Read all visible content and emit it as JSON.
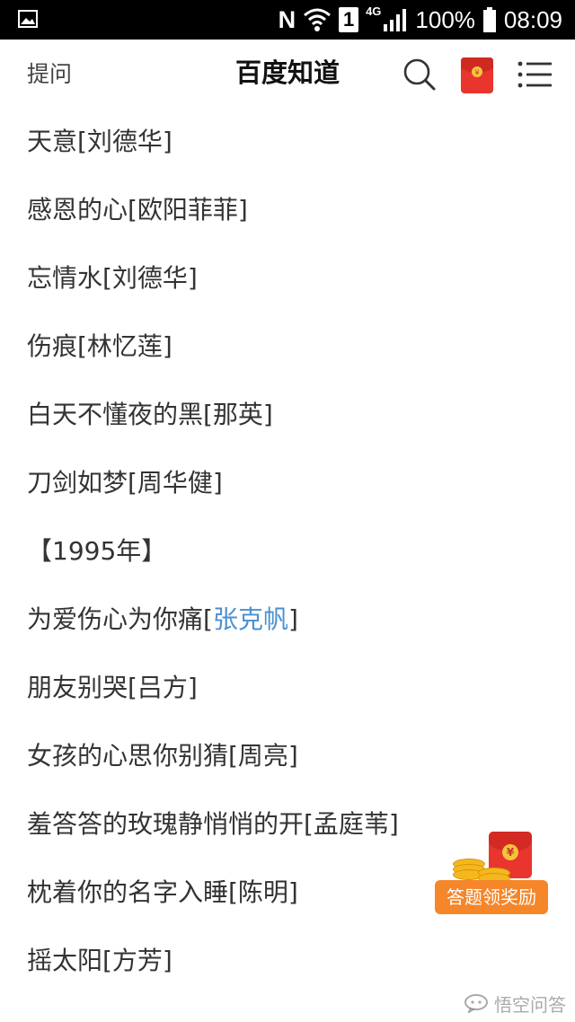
{
  "status_bar": {
    "network_letter": "N",
    "sim_slot": "1",
    "network_type": "4G",
    "battery": "100%",
    "time": "08:09"
  },
  "header": {
    "ask_label": "提问",
    "title": "百度知道"
  },
  "songs": [
    "天意[刘德华]",
    "感恩的心[欧阳菲菲]",
    "忘情水[刘德华]",
    "伤痕[林忆莲]",
    "白天不懂夜的黑[那英]",
    "刀剑如梦[周华健]",
    "【1995年】",
    {
      "title": "为爱伤心为你痛[",
      "artist_link": "张克帆",
      "suffix": "]"
    },
    "朋友别哭[吕方]",
    "女孩的心思你别猜[周亮]",
    "羞答答的玫瑰静悄悄的开[孟庭苇]",
    "枕着你的名字入睡[陈明]",
    "摇太阳[方芳]"
  ],
  "reward_widget": {
    "label": "答题领奖励",
    "coin_symbol": "¥"
  },
  "watermark": {
    "text": "悟空问答"
  },
  "colors": {
    "link": "#4a90cf",
    "reward_orange": "#f5862a",
    "red_packet": "#e8352d"
  }
}
